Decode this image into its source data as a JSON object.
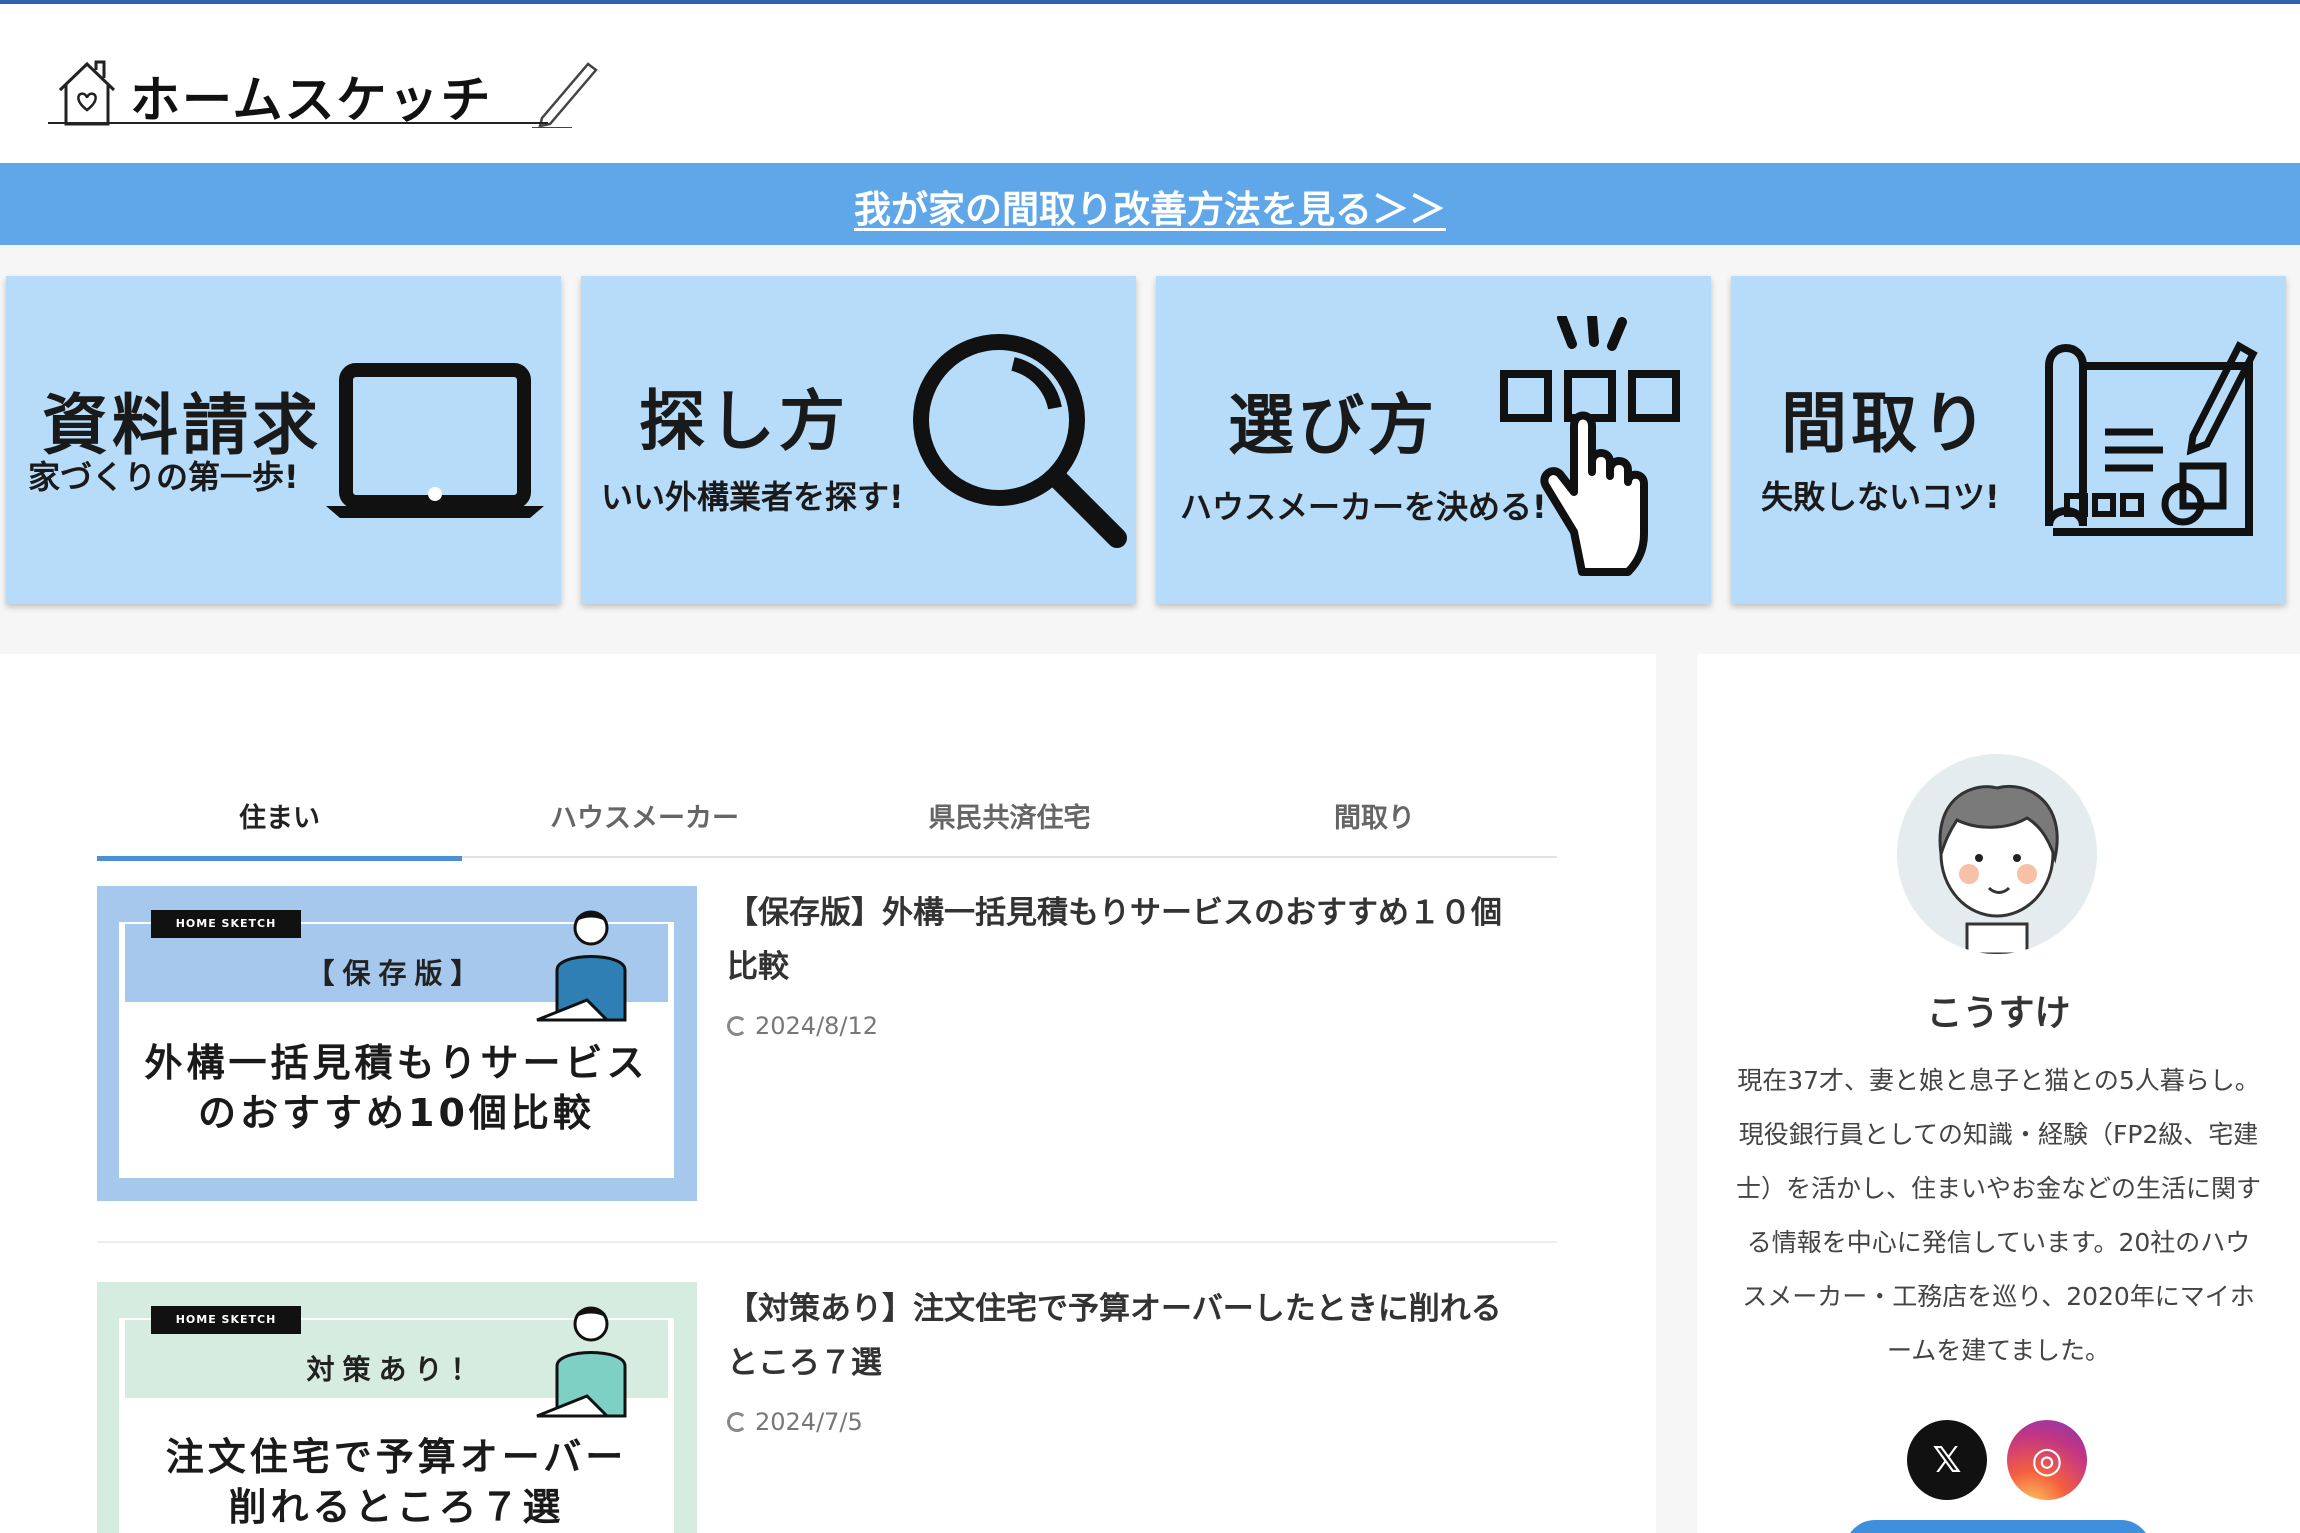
{
  "site": {
    "logo_text": "ホームスケッチ",
    "colors": {
      "topline": "#2f63b0",
      "notice_bg": "#5fa7e8",
      "card_bg": "#b6dcf9",
      "tab_accent": "#4a90d9"
    }
  },
  "notice": {
    "link_text": "我が家の間取り改善方法を見る＞＞"
  },
  "cards": [
    {
      "title": "資料請求",
      "sub": "家づくりの第一歩!",
      "icon": "laptop-icon"
    },
    {
      "title": "探し方",
      "sub": "いい外構業者を探す!",
      "icon": "magnifier-icon"
    },
    {
      "title": "選び方",
      "sub": "ハウスメーカーを決める!",
      "icon": "pointer-hand-icon"
    },
    {
      "title": "間取り",
      "sub": "失敗しないコツ!",
      "icon": "blueprint-icon"
    }
  ],
  "tabs": [
    {
      "label": "住まい",
      "active": true
    },
    {
      "label": "ハウスメーカー",
      "active": false
    },
    {
      "label": "県民共済住宅",
      "active": false
    },
    {
      "label": "間取り",
      "active": false
    }
  ],
  "posts": [
    {
      "thumb_brand": "HOME SKETCH",
      "thumb_tag": "【保存版】",
      "thumb_title_1": "外構一括見積もりサービス",
      "thumb_title_2": "のおすすめ10個比較",
      "title": "【保存版】外構一括見積もりサービスのおすすめ１０個比較",
      "date": "2024/8/12"
    },
    {
      "thumb_brand": "HOME SKETCH",
      "thumb_tag": "対策あり！",
      "thumb_title_1": "注文住宅で予算オーバー",
      "thumb_title_2": "削れるところ７選",
      "title": "【対策あり】注文住宅で予算オーバーしたときに削れるところ７選",
      "date": "2024/7/5"
    }
  ],
  "profile": {
    "name": "こうすけ",
    "bio": "現在37才、妻と娘と息子と猫との5人暮らし。現役銀行員としての知識・経験（FP2級、宅建士）を活かし、住まいやお金などの生活に関する情報を中心に発信しています。20社のハウスメーカー・工務店を巡り、2020年にマイホームを建てました。",
    "social": [
      {
        "icon": "x-icon",
        "glyph": "𝕏"
      },
      {
        "icon": "instagram-icon",
        "glyph": "◎"
      }
    ]
  }
}
